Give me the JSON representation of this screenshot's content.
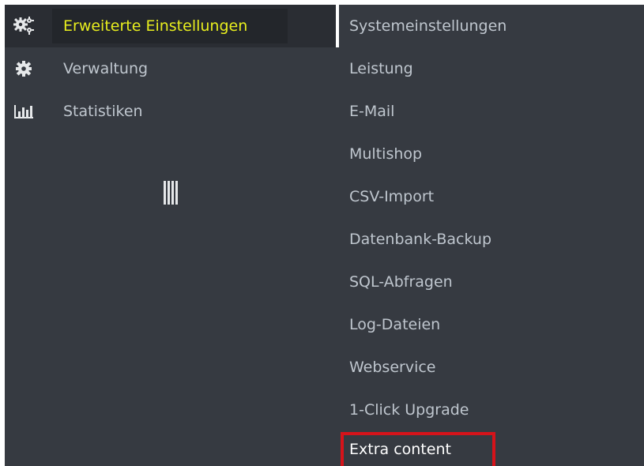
{
  "left_menu": {
    "items": [
      {
        "label": "Erweiterte Einstellungen",
        "icon": "gears-icon",
        "active": true
      },
      {
        "label": "Verwaltung",
        "icon": "gear-icon",
        "active": false
      },
      {
        "label": "Statistiken",
        "icon": "bar-chart-icon",
        "active": false
      }
    ],
    "collapse_icon": "collapse-handle-icon"
  },
  "submenu": {
    "items": [
      {
        "label": "Systemeinstellungen"
      },
      {
        "label": "Leistung"
      },
      {
        "label": "E-Mail"
      },
      {
        "label": "Multishop"
      },
      {
        "label": "CSV-Import"
      },
      {
        "label": "Datenbank-Backup"
      },
      {
        "label": "SQL-Abfragen"
      },
      {
        "label": "Log-Dateien"
      },
      {
        "label": "Webservice"
      },
      {
        "label": "1-Click Upgrade"
      },
      {
        "label": "Extra content"
      }
    ],
    "highlighted": "Extra content"
  },
  "colors": {
    "background": "#363a41",
    "active_text": "#e8ee1e",
    "text": "#bfc6ce",
    "highlight_border": "#d6131a"
  }
}
